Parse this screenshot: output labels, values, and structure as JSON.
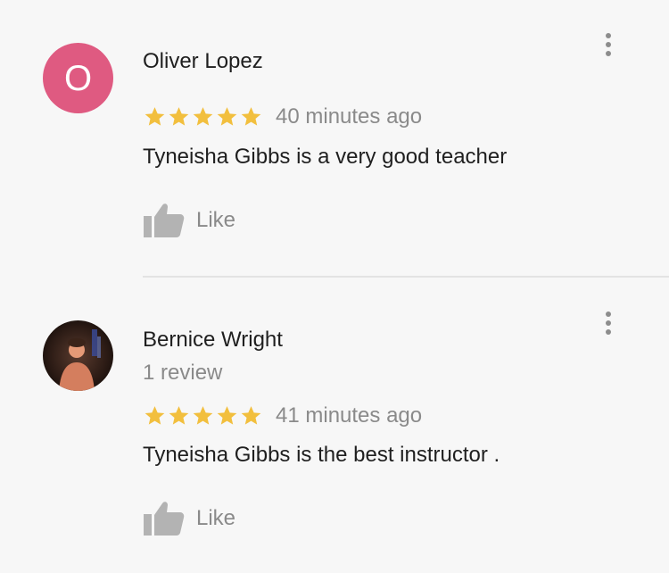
{
  "colors": {
    "star": "#f2bf3e",
    "avatar_o": "#df5a81",
    "muted_text": "#8a8a8a",
    "like_icon": "#b3b3b3"
  },
  "reviews": [
    {
      "avatar_letter": "O",
      "name": "Oliver Lopez",
      "rating": 5,
      "time": "40 minutes ago",
      "text": "Tyneisha Gibbs is a very good teacher",
      "like_label": "Like",
      "more_icon": "more-vert-icon"
    },
    {
      "avatar_letter": "",
      "name": "Bernice Wright",
      "review_count": "1 review",
      "rating": 5,
      "time": "41 minutes ago",
      "text": "Tyneisha Gibbs is the best instructor .",
      "like_label": "Like",
      "more_icon": "more-vert-icon"
    }
  ]
}
